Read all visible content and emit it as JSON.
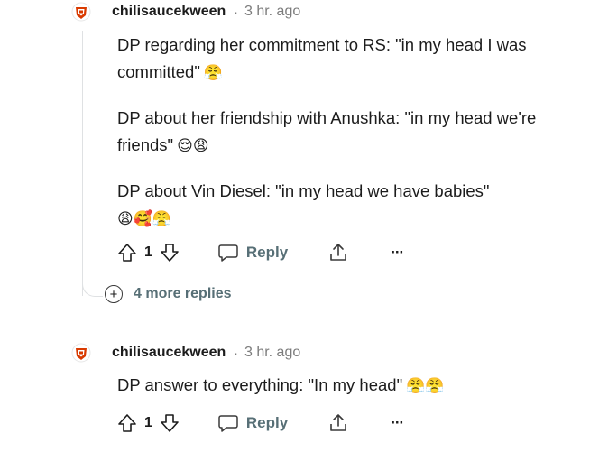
{
  "comments": [
    {
      "author": "chilisaucekween",
      "separator": "·",
      "time": "3 hr. ago",
      "paragraphs": [
        {
          "text": "DP regarding her commitment to RS: \"in my head I was committed\"",
          "emoji": "😤"
        },
        {
          "text": "DP about her friendship with Anushka: \"in my head we're friends\"",
          "emoji": "😌😩"
        },
        {
          "text": "DP about Vin Diesel: \"in my head we have babies\"",
          "emoji": "😩🥰😤"
        }
      ],
      "votes": "1",
      "reply_label": "Reply",
      "more_label": "···"
    },
    {
      "author": "chilisaucekween",
      "separator": "·",
      "time": "3 hr. ago",
      "paragraphs": [
        {
          "text": "DP answer to everything: \"In my head\"",
          "emoji": "😤😤"
        }
      ],
      "votes": "1",
      "reply_label": "Reply",
      "more_label": "···"
    }
  ],
  "more_replies": {
    "icon": "+",
    "label": "4 more replies"
  },
  "colors": {
    "text": "#1c1c1c",
    "muted": "#7c7c7c",
    "action": "#576f76",
    "line": "#dfe1e3",
    "avatar": "#d93a00"
  }
}
